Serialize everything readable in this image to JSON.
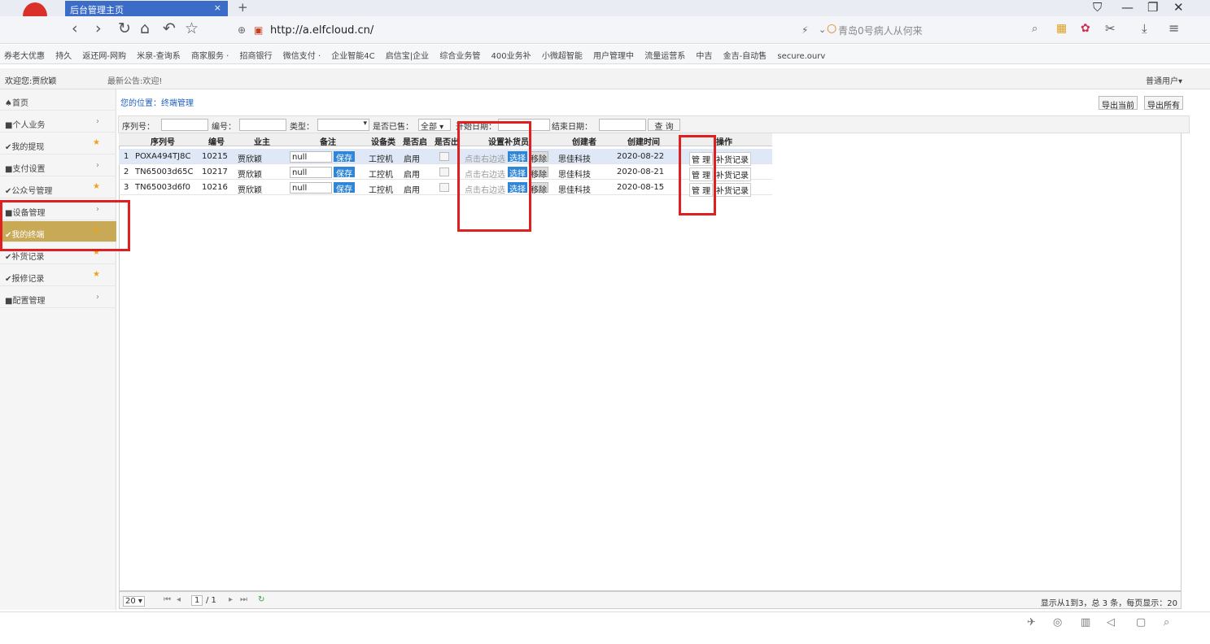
{
  "browser": {
    "tab_title": "后台管理主页",
    "tab_close": "×",
    "new_tab": "+",
    "url": "http://a.elfcloud.cn/",
    "search_placeholder": "青岛0号病人从何来",
    "bookmarks": [
      "券老大优惠",
      "持久",
      "返还网-网购",
      "米泉-查询系",
      "商家服务 ·",
      "招商银行",
      "微信支付 ·",
      "企业智能4C",
      "启信宝|企业",
      "综合业务管",
      "400业务补",
      "小微超智能",
      "用户管理中",
      "流量运营系",
      "中吉",
      "金吉-自动售",
      "secure.ourv"
    ]
  },
  "header": {
    "welcome": "欢迎您:贾欣颖",
    "notice": "最新公告:欢迎!",
    "user_menu": "普通用户▾"
  },
  "sidebar": {
    "items": [
      {
        "label": "首页",
        "prefix": "♠",
        "suffix": ""
      },
      {
        "label": "个人业务",
        "prefix": "■",
        "suffix": "›"
      },
      {
        "label": "我的提现",
        "prefix": "✔",
        "suffix": "★"
      },
      {
        "label": "支付设置",
        "prefix": "■",
        "suffix": "›"
      },
      {
        "label": "公众号管理",
        "prefix": "✔",
        "suffix": "★"
      },
      {
        "label": "设备管理",
        "prefix": "■",
        "suffix": "›"
      },
      {
        "label": "我的终端",
        "prefix": "✔",
        "suffix": "★"
      },
      {
        "label": "补货记录",
        "prefix": "✔",
        "suffix": "★"
      },
      {
        "label": "报修记录",
        "prefix": "✔",
        "suffix": "★"
      },
      {
        "label": "配置管理",
        "prefix": "■",
        "suffix": "›"
      }
    ]
  },
  "main": {
    "breadcrumb": "您的位置：终端管理",
    "export_current": "导出当前",
    "export_all": "导出所有",
    "filter": {
      "serial_label": "序列号：",
      "number_label": "编号：",
      "type_label": "类型：",
      "sold_label": "是否已售：",
      "sold_value": "全部 ▾",
      "start_label": "开始日期：",
      "end_label": "结束日期：",
      "query": "查 询"
    },
    "columns": [
      "序列号",
      "编号",
      "业主",
      "备注",
      "设备类型",
      "是否启用",
      "是否出售",
      "设置补货员",
      "创建者",
      "创建时间",
      "操作"
    ],
    "rows": [
      {
        "idx": "1",
        "serial": "POXA494TJ8C",
        "no": "10215",
        "owner": "贾欣颖",
        "note": "null",
        "save": "保存",
        "type": "工控机",
        "enabled": "启用",
        "hint": "点击右边选",
        "choose": "选择",
        "remove": "移除",
        "creator": "思佳科技",
        "created": "2020-08-22",
        "manage": "管 理",
        "restock": "补货记录"
      },
      {
        "idx": "2",
        "serial": "TN65003d65C",
        "no": "10217",
        "owner": "贾欣颖",
        "note": "null",
        "save": "保存",
        "type": "工控机",
        "enabled": "启用",
        "hint": "点击右边选",
        "choose": "选择",
        "remove": "移除",
        "creator": "思佳科技",
        "created": "2020-08-21",
        "manage": "管 理",
        "restock": "补货记录"
      },
      {
        "idx": "3",
        "serial": "TN65003d6f0",
        "no": "10216",
        "owner": "贾欣颖",
        "note": "null",
        "save": "保存",
        "type": "工控机",
        "enabled": "启用",
        "hint": "点击右边选",
        "choose": "选择",
        "remove": "移除",
        "creator": "思佳科技",
        "created": "2020-08-15",
        "manage": "管 理",
        "restock": "补货记录"
      }
    ],
    "pager": {
      "page_size": "20 ▾",
      "page": "1",
      "total_pages": "/ 1",
      "summary": "显示从1到3，总 3 条，每页显示：20"
    }
  },
  "colors": {
    "accent": "#2f86d6",
    "active_sidebar": "#c8a956",
    "highlight": "#e02020"
  }
}
